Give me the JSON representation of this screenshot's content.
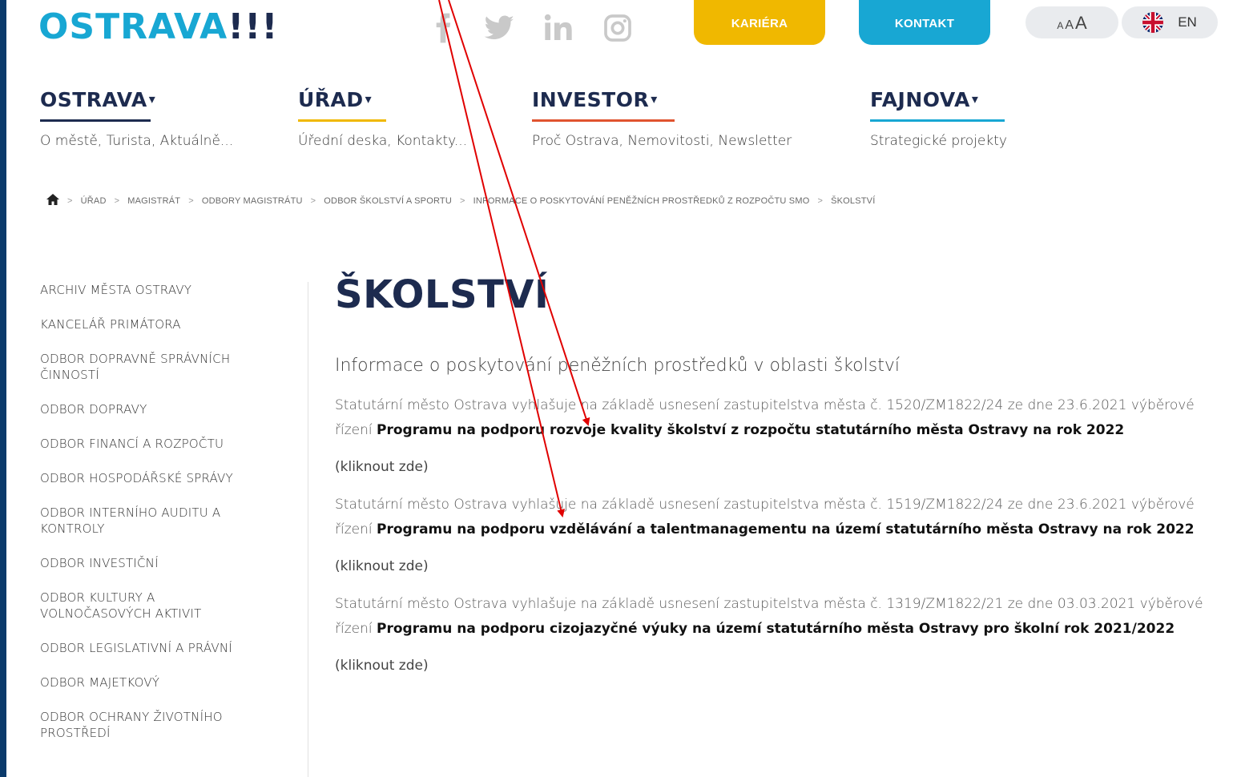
{
  "header": {
    "logo_main": "OSTRAVA",
    "logo_bang": "!!!",
    "careers_label": "KARIÉRA",
    "contact_label": "KONTAKT",
    "font_size_small": "A",
    "font_size_medium": "A",
    "font_size_large": "A",
    "lang_label": "EN",
    "social": [
      "facebook-icon",
      "twitter-icon",
      "linkedin-icon",
      "instagram-icon"
    ]
  },
  "nav": [
    {
      "title": "OSTRAVA",
      "sub": "O městě, Turista, Aktuálně...",
      "color": "#1d2b4f"
    },
    {
      "title": "ÚŘAD",
      "sub": "Úřední deska, Kontakty...",
      "color": "#f0b800"
    },
    {
      "title": "INVESTOR",
      "sub": "Proč Ostrava, Nemovitosti, Newsletter",
      "color": "#e0532f"
    },
    {
      "title": "FAJNOVA",
      "sub": "Strategické projekty",
      "color": "#18a7d3"
    }
  ],
  "breadcrumb": [
    "ÚŘAD",
    "MAGISTRÁT",
    "ODBORY MAGISTRÁTU",
    "ODBOR ŠKOLSTVÍ A SPORTU",
    "INFORMACE O POSKYTOVÁNÍ PENĚŽNÍCH PROSTŘEDKŮ Z ROZPOČTU SMO",
    "ŠKOLSTVÍ"
  ],
  "sidebar": {
    "items": [
      "ARCHIV MĚSTA OSTRAVY",
      "KANCELÁŘ PRIMÁTORA",
      "ODBOR DOPRAVNĚ SPRÁVNÍCH ČINNOSTÍ",
      "ODBOR DOPRAVY",
      "ODBOR FINANCÍ A ROZPOČTU",
      "ODBOR HOSPODÁŘSKÉ SPRÁVY",
      "ODBOR INTERNÍHO AUDITU A KONTROLY",
      "ODBOR INVESTIČNÍ",
      "ODBOR KULTURY A VOLNOČASOVÝCH AKTIVIT",
      "ODBOR LEGISLATIVNÍ A PRÁVNÍ",
      "ODBOR MAJETKOVÝ",
      "ODBOR OCHRANY ŽIVOTNÍHO PROSTŘEDÍ"
    ]
  },
  "content": {
    "title": "ŠKOLSTVÍ",
    "lead": "Informace o poskytování peněžních prostředků v oblasti školství",
    "sections": [
      {
        "intro": "Statutární město Ostrava vyhlašuje na základě usnesení zastupitelstva města č. 1520/ZM1822/24 ze dne 23.6.2021 výběrové řízení ",
        "program": "Programu na podporu rozvoje kvality školství z rozpočtu statutárního města Ostravy na rok 2022",
        "link": "(kliknout zde)"
      },
      {
        "intro": "Statutární město Ostrava vyhlašuje na základě usnesení zastupitelstva města č. 1519/ZM1822/24 ze dne 23.6.2021  výběrové řízení ",
        "program": "Programu na podporu vzdělávání a talentmanagementu na území statutárního města Ostravy na rok 2022",
        "link": "(kliknout zde)"
      },
      {
        "intro": "Statutární město Ostrava vyhlašuje na základě usnesení zastupitelstva města č. 1319/ZM1822/21 ze dne 03.03.2021 výběrové řízení ",
        "program": "Programu na podporu cizojazyčné výuky na území statutárního města Ostravy pro školní rok 2021/2022",
        "link": "(kliknout zde)"
      }
    ]
  },
  "colors": {
    "frame": "#0a3a6b",
    "brand_blue": "#18a7d3",
    "brand_navy": "#1d2b4f",
    "careers_yellow": "#f0b800",
    "annotation_red": "#e00000"
  }
}
